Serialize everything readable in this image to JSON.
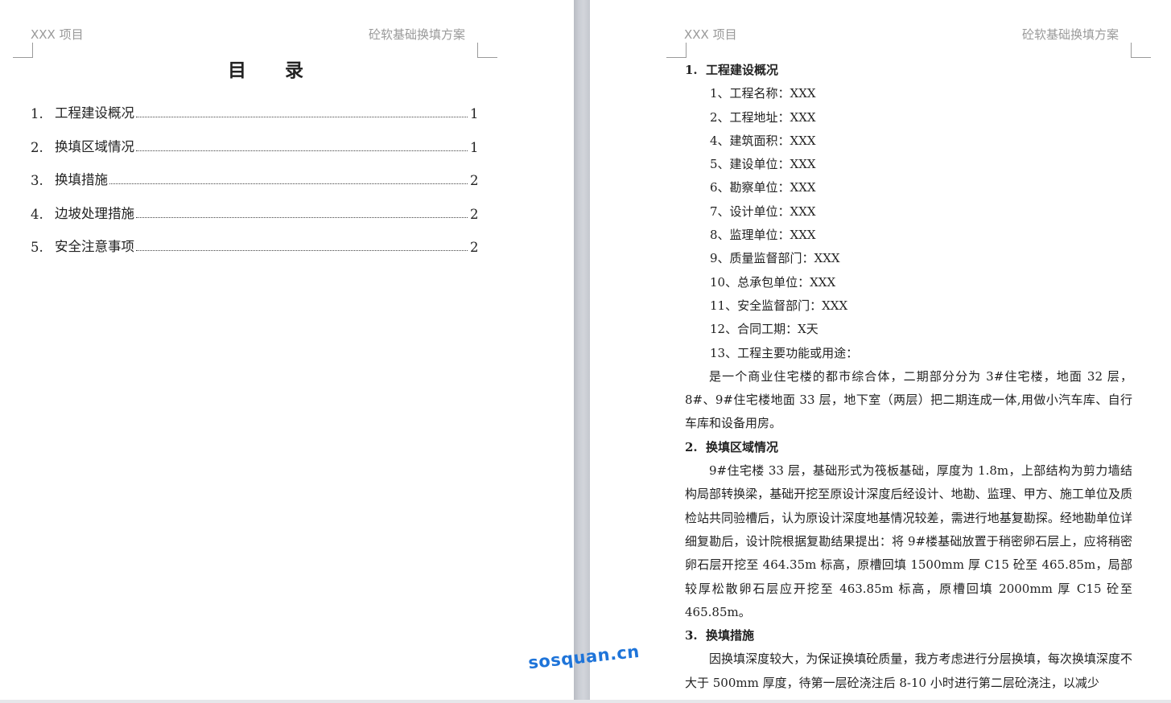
{
  "header": {
    "left": "XXX 项目",
    "right": "砼软基础换填方案"
  },
  "toc": {
    "title": "目 录",
    "entries": [
      {
        "num": "1.",
        "text": "工程建设概况",
        "page": "1"
      },
      {
        "num": "2.",
        "text": "换填区域情况",
        "page": "1"
      },
      {
        "num": "3.",
        "text": "换填措施",
        "page": "2"
      },
      {
        "num": "4.",
        "text": "边坡处理措施",
        "page": "2"
      },
      {
        "num": "5.",
        "text": "安全注意事项",
        "page": "2"
      }
    ]
  },
  "content": {
    "s1": {
      "num": "1.",
      "title": "工程建设概况"
    },
    "items": [
      "1、工程名称：XXX",
      "2、工程地址：XXX",
      "4、建筑面积：XXX",
      "5、建设单位：XXX",
      "6、勘察单位：XXX",
      "7、设计单位：XXX",
      "8、监理单位：XXX",
      "9、质量监督部门：XXX",
      "10、总承包单位：XXX",
      "11、安全监督部门：XXX",
      "12、合同工期：X天",
      "13、工程主要功能或用途："
    ],
    "p1": "是一个商业住宅楼的都市综合体，二期部分分为 3#住宅楼，地面 32 层，8#、9#住宅楼地面 33 层，地下室（两层）把二期连成一体,用做小汽车库、自行车库和设备用房。",
    "s2": {
      "num": "2.",
      "title": "换填区域情况"
    },
    "p2": "9#住宅楼 33 层，基础形式为筏板基础，厚度为 1.8m，上部结构为剪力墙结构局部转换梁，基础开挖至原设计深度后经设计、地勘、监理、甲方、施工单位及质检站共同验槽后，认为原设计深度地基情况较差，需进行地基复勘探。经地勘单位详细复勘后，设计院根据复勘结果提出：将 9#楼基础放置于稍密卵石层上，应将稍密卵石层开挖至 464.35m 标高，原槽回填 1500mm 厚 C15 砼至 465.85m，局部较厚松散卵石层应开挖至 463.85m 标高，原槽回填 2000mm 厚 C15 砼至 465.85m。",
    "s3": {
      "num": "3.",
      "title": "换填措施"
    },
    "p3": "因换填深度较大，为保证换填砼质量，我方考虑进行分层换填，每次换填深度不大于 500mm 厚度，待第一层砼浇注后 8-10 小时进行第二层砼浇注，以减少"
  },
  "watermark": "sosquan.cn"
}
